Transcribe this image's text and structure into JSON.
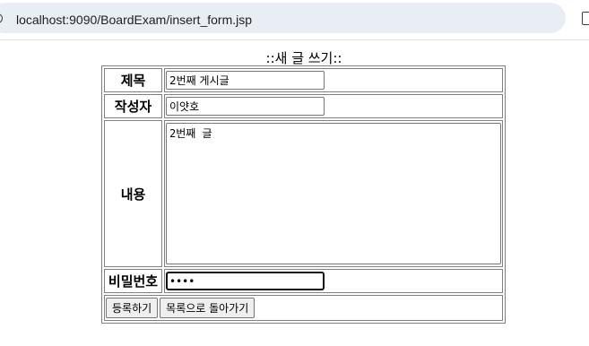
{
  "browser": {
    "url": "localhost:9090/BoardExam/insert_form.jsp",
    "info_icon": "info-icon",
    "extension_icon": "tab-icon"
  },
  "page": {
    "title": "::새 글 쓰기::"
  },
  "form": {
    "title_label": "제목",
    "title_value": "2번째 게시글",
    "writer_label": "작성자",
    "writer_value": "이얏호",
    "content_label": "내용",
    "content_value": "2번째 글",
    "password_label": "비밀번호",
    "password_value": "1234",
    "submit_label": "등록하기",
    "back_label": "목록으로 돌아가기"
  }
}
